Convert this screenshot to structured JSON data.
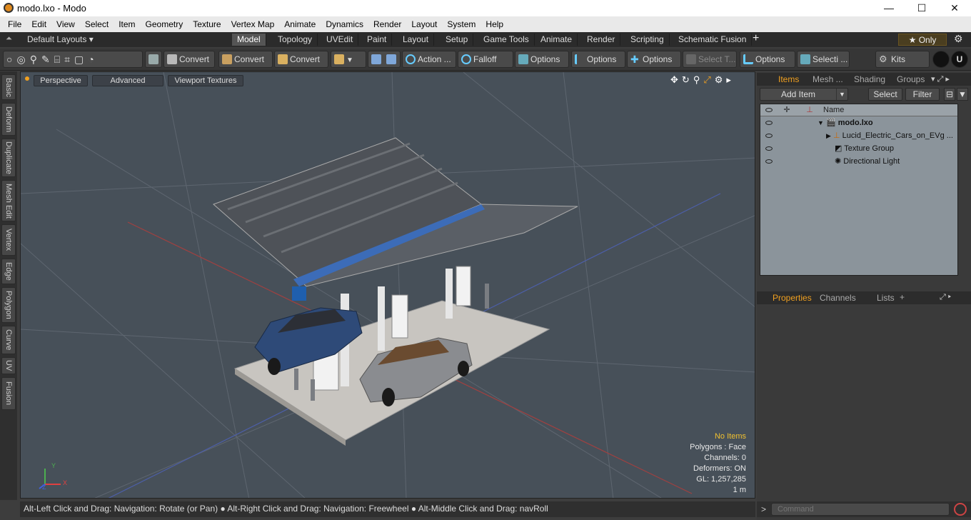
{
  "window": {
    "title": "modo.lxo - Modo",
    "minimize": "—",
    "maximize": "☐",
    "close": "✕"
  },
  "menu": [
    "File",
    "Edit",
    "View",
    "Select",
    "Item",
    "Geometry",
    "Texture",
    "Vertex Map",
    "Animate",
    "Dynamics",
    "Render",
    "Layout",
    "System",
    "Help"
  ],
  "layouts": {
    "current": "Default Layouts ▾",
    "tabs": [
      "Model",
      "Topology",
      "UVEdit",
      "Paint",
      "Layout",
      "Setup",
      "Game Tools",
      "Animate",
      "Render",
      "Scripting",
      "Schematic Fusion"
    ],
    "active": "Model",
    "add": "+",
    "only": "★  Only"
  },
  "toolbar": {
    "convert1": "Convert",
    "convert2": "Convert",
    "convert3": "Convert",
    "action": "Action  ...",
    "falloff": "Falloff",
    "options1": "Options",
    "options2": "Options",
    "options3": "Options",
    "select_t": "Select T...",
    "options4": "Options",
    "selecti": "Selecti ...",
    "kits": "Kits"
  },
  "left_tabs": [
    "Basic",
    "Deform",
    "Duplicate",
    "Mesh Edit",
    "Vertex",
    "Edge",
    "Polygon",
    "Curve",
    "UV",
    "Fusion"
  ],
  "viewport": {
    "perspective": "Perspective",
    "advanced": "Advanced",
    "textures": "Viewport Textures",
    "info": {
      "items": "No Items",
      "polygons": "Polygons : Face",
      "channels": "Channels: 0",
      "deformers": "Deformers: ON",
      "gl": "GL: 1,257,285",
      "scale": "1 m"
    },
    "axis_y": "Y",
    "axis_x": "X",
    "axis_z": "Z"
  },
  "status": "Alt-Left Click and Drag: Navigation: Rotate (or Pan) ● Alt-Right Click and Drag: Navigation: Freewheel ● Alt-Middle Click and Drag: navRoll",
  "items_panel": {
    "tabs": [
      "Items",
      "Mesh ...",
      "Shading",
      "Groups"
    ],
    "add_item": "Add Item",
    "select": "Select",
    "filter": "Filter",
    "col_name": "Name",
    "rows": [
      {
        "name": "modo.lxo",
        "indent": 0
      },
      {
        "name": "Lucid_Electric_Cars_on_EVg ...",
        "indent": 1
      },
      {
        "name": "Texture Group",
        "indent": 1
      },
      {
        "name": "Directional Light",
        "indent": 1
      }
    ]
  },
  "props_panel": {
    "tabs": [
      "Properties",
      "Channels",
      "Lists"
    ],
    "add": "+"
  },
  "command": {
    "placeholder": "Command"
  },
  "colors": {
    "accent": "#f0a020",
    "viewport_bg": "#475059"
  }
}
